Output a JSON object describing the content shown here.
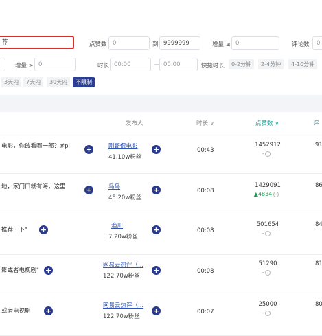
{
  "filters": {
    "keyword_value": "荐",
    "likes_label": "点赞数",
    "likes_min": "0",
    "to_label": "到",
    "likes_max": "9999999",
    "increase_label": "增量 ≥",
    "increase_value": "0",
    "comments_label": "评论数",
    "comments_min": "0",
    "row2_increase_label": "增量 ≥",
    "row2_increase_value": "0",
    "duration_label": "时长",
    "duration_from": "00:00",
    "duration_sep": "—",
    "duration_to": "00:00",
    "quick_duration_label": "快捷时长",
    "quick_durations": [
      "0-2分钟",
      "2-4分钟",
      "4-10分钟"
    ],
    "time_ranges": [
      "3天内",
      "7天内",
      "30天内",
      "不限制"
    ],
    "active_time_range": "不限制"
  },
  "columns": {
    "publisher": "发布人",
    "duration": "时长",
    "likes": "点赞数",
    "comments": "评"
  },
  "rows": [
    {
      "title": "电影，你敢看哪一部？#pi",
      "author": "刚哥侃电影",
      "fans": "41.10w粉丝",
      "duration": "00:43",
      "likes": "1452912",
      "delta": "-",
      "delta_up": false,
      "comments": "91"
    },
    {
      "title": "地，家门口就有海，这里",
      "author": "乌乌",
      "fans": "45.20w粉丝",
      "duration": "00:08",
      "likes": "1429091",
      "delta": "4834",
      "delta_up": true,
      "comments": "86"
    },
    {
      "title": "推荐一下\"",
      "author": "渔川",
      "fans": "7.20w粉丝",
      "duration": "00:08",
      "likes": "501654",
      "delta": "-",
      "delta_up": false,
      "comments": "84"
    },
    {
      "title": "影或者电视剧\"",
      "author": "网易云热评（...",
      "fans": "122.70w粉丝",
      "duration": "00:08",
      "likes": "51290",
      "delta": "-",
      "delta_up": false,
      "comments": "81"
    },
    {
      "title": "或者电视剧",
      "author": "网易云热评（...",
      "fans": "122.70w粉丝",
      "duration": "00:07",
      "likes": "25000",
      "delta": "-",
      "delta_up": false,
      "comments": "80"
    }
  ]
}
